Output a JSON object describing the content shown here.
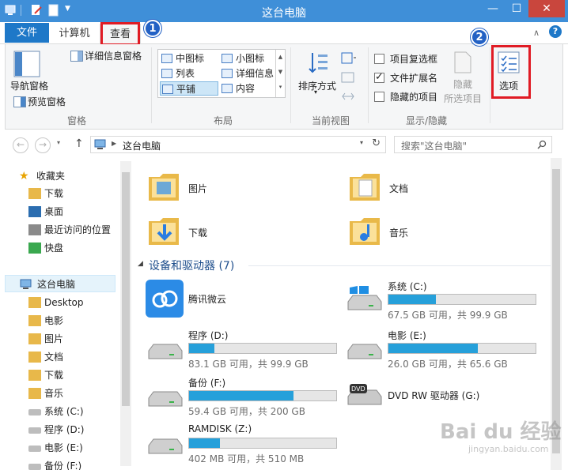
{
  "window": {
    "title": "这台电脑"
  },
  "ribbon_tabs": {
    "file": "文件",
    "computer": "计算机",
    "view": "查看"
  },
  "callouts": {
    "one": "1",
    "two": "2"
  },
  "panes_group": {
    "nav_pane": "导航窗格",
    "preview_pane": "预览窗格",
    "details_pane": "详细信息窗格",
    "label": "窗格"
  },
  "layout_group": {
    "items": [
      "中图标",
      "小图标",
      "列表",
      "详细信息",
      "平铺",
      "内容"
    ],
    "selected": "平铺",
    "label": "布局"
  },
  "current_view_group": {
    "sort_by": "排序方式",
    "label": "当前视图"
  },
  "show_hide_group": {
    "item_checkboxes": "项目复选框",
    "file_extensions": "文件扩展名",
    "hidden_items": "隐藏的项目",
    "hide_selected_line1": "隐藏",
    "hide_selected_line2": "所选项目",
    "label": "显示/隐藏",
    "item_checkboxes_checked": false,
    "file_extensions_checked": true,
    "hidden_items_checked": false
  },
  "options_button": {
    "label": "选项"
  },
  "address_bar": {
    "path": "这台电脑",
    "search_placeholder": "搜索\"这台电脑\""
  },
  "nav_pane": {
    "favorites": "收藏夹",
    "favorites_items": [
      "下载",
      "桌面",
      "最近访问的位置",
      "快盘"
    ],
    "this_pc": "这台电脑",
    "this_pc_items": [
      "Desktop",
      "电影",
      "图片",
      "文档",
      "下载",
      "音乐",
      "系统 (C:)",
      "程序 (D:)",
      "电影 (E:)",
      "备份 (F:)"
    ]
  },
  "folders": [
    {
      "name": "图片"
    },
    {
      "name": "文档"
    },
    {
      "name": "下载"
    },
    {
      "name": "音乐"
    }
  ],
  "devices_section": {
    "title": "设备和驱动器 (7)"
  },
  "drives": [
    {
      "name": "腾讯微云",
      "info": "",
      "used_fraction": null
    },
    {
      "name": "系统 (C:)",
      "info": "67.5 GB 可用，共 99.9 GB",
      "used_fraction": 0.32
    },
    {
      "name": "程序 (D:)",
      "info": "83.1 GB 可用，共 99.9 GB",
      "used_fraction": 0.17
    },
    {
      "name": "电影 (E:)",
      "info": "26.0 GB 可用，共 65.6 GB",
      "used_fraction": 0.6
    },
    {
      "name": "备份 (F:)",
      "info": "59.4 GB 可用，共 200 GB",
      "used_fraction": 0.7
    },
    {
      "name": "DVD RW 驱动器 (G:)",
      "info": "",
      "used_fraction": null
    },
    {
      "name": "RAMDISK (Z:)",
      "info": "402 MB 可用，共 510 MB",
      "used_fraction": 0.21
    }
  ],
  "watermark": {
    "line1": "Bai du 经验",
    "line2": "jingyan.baidu.com"
  },
  "colors": {
    "titlebar": "#3f8fd8",
    "accent": "#1e78c8",
    "highlight": "#e01b24",
    "badge": "#2361c4",
    "drive_bar": "#26a0da"
  }
}
